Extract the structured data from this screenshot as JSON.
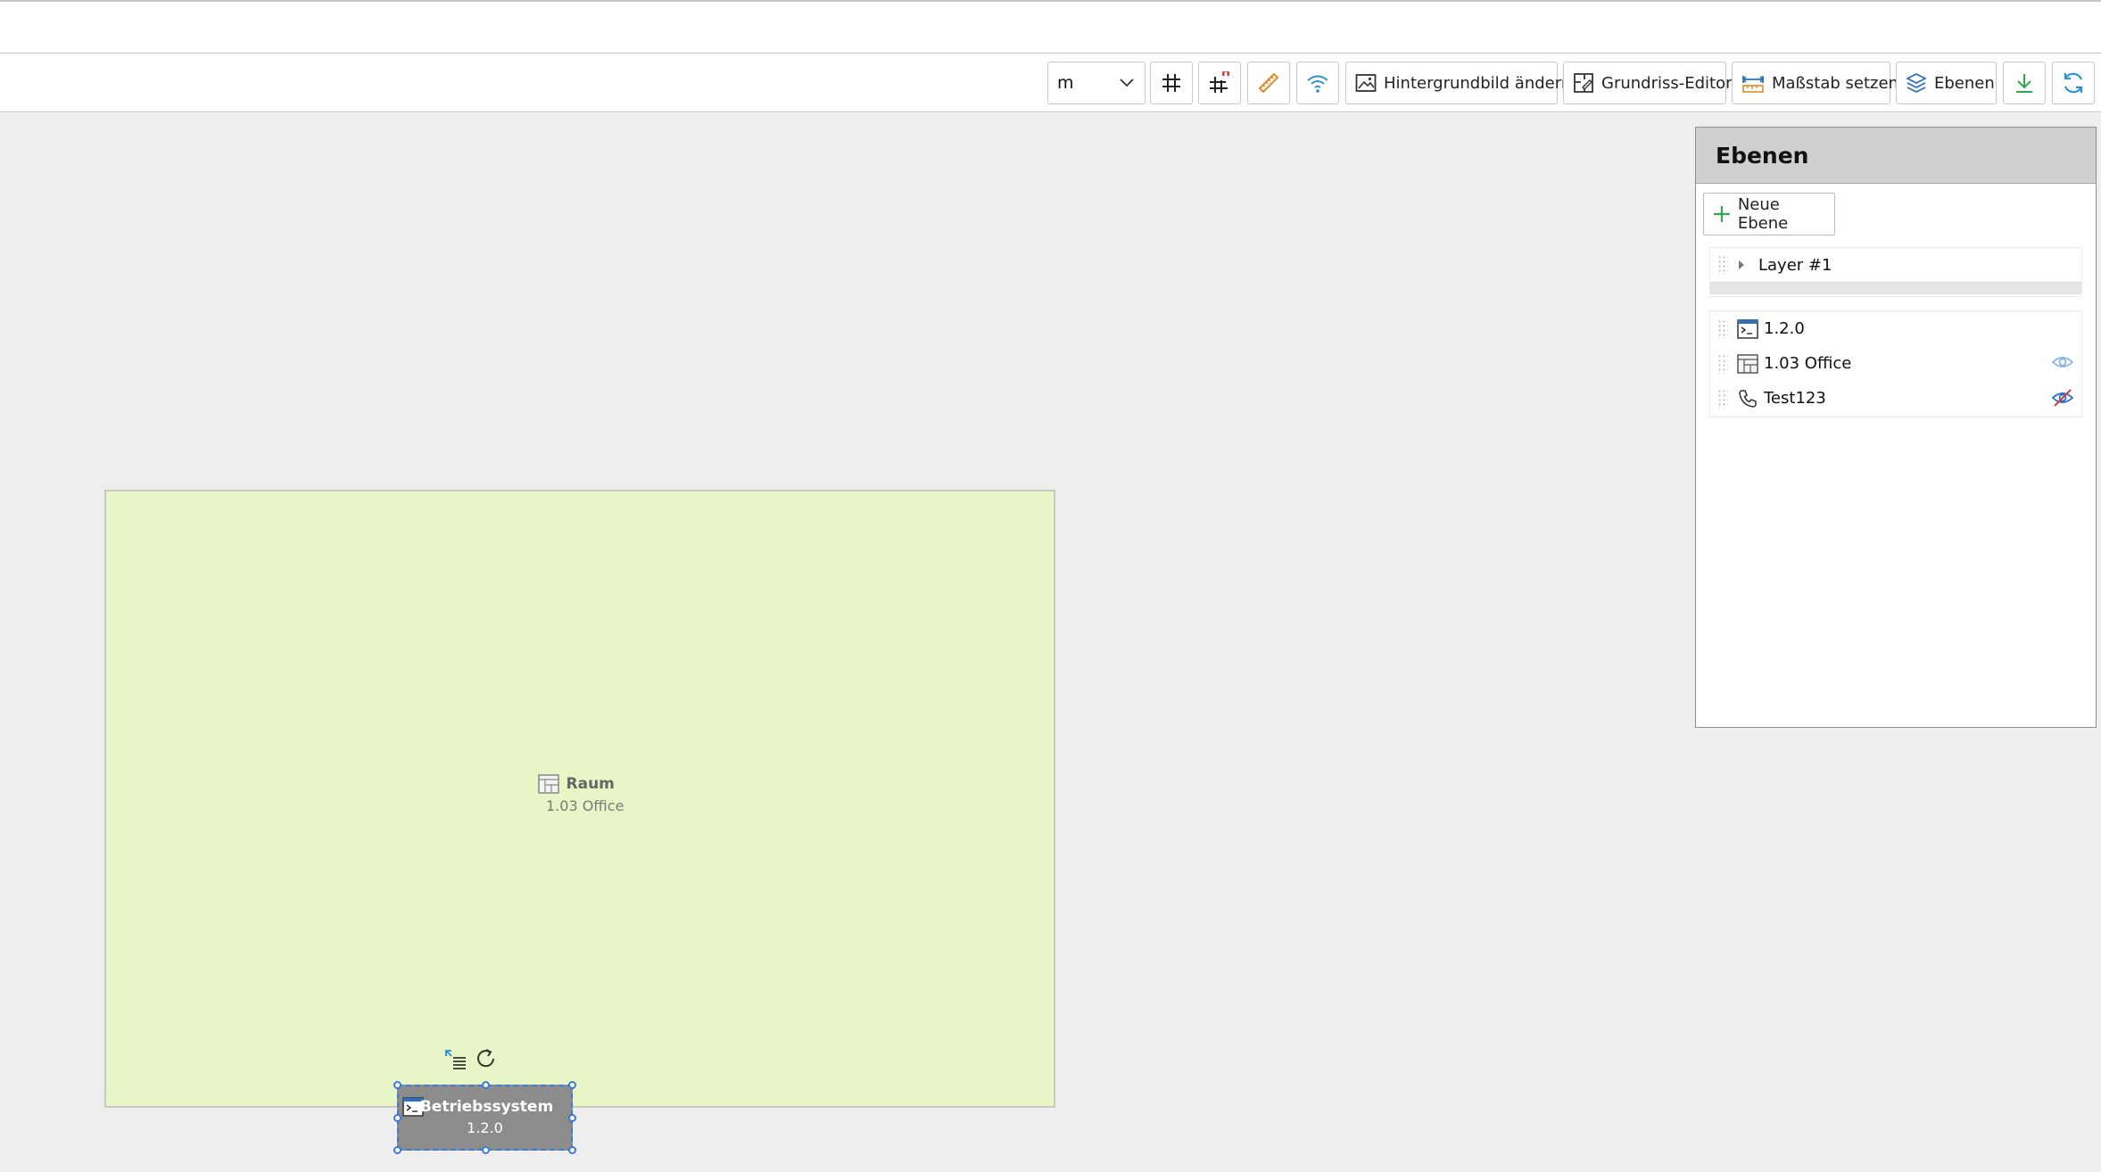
{
  "toolbar": {
    "unit_value": "m",
    "background_label": "Hintergrundbild ändern",
    "floorplan_editor_label": "Grundriss-Editor",
    "scale_label": "Maßstab setzen",
    "layers_label": "Ebenen"
  },
  "canvas": {
    "room": {
      "type_label": "Raum",
      "name": "1.03 Office",
      "fill_color": "#e8f5c6"
    },
    "device": {
      "title": "Betriebssystem",
      "version": "1.2.0",
      "selection_color": "#3a7bd5"
    }
  },
  "layers_panel": {
    "title": "Ebenen",
    "new_layer_label": "Neue Ebene",
    "layer_name": "Layer #1",
    "items": [
      {
        "label": "1.2.0",
        "icon": "terminal-window-icon",
        "visibility": "none"
      },
      {
        "label": "1.03 Office",
        "icon": "room-icon",
        "visibility": "visible"
      },
      {
        "label": "Test123",
        "icon": "phone-icon",
        "visibility": "hidden"
      }
    ]
  }
}
